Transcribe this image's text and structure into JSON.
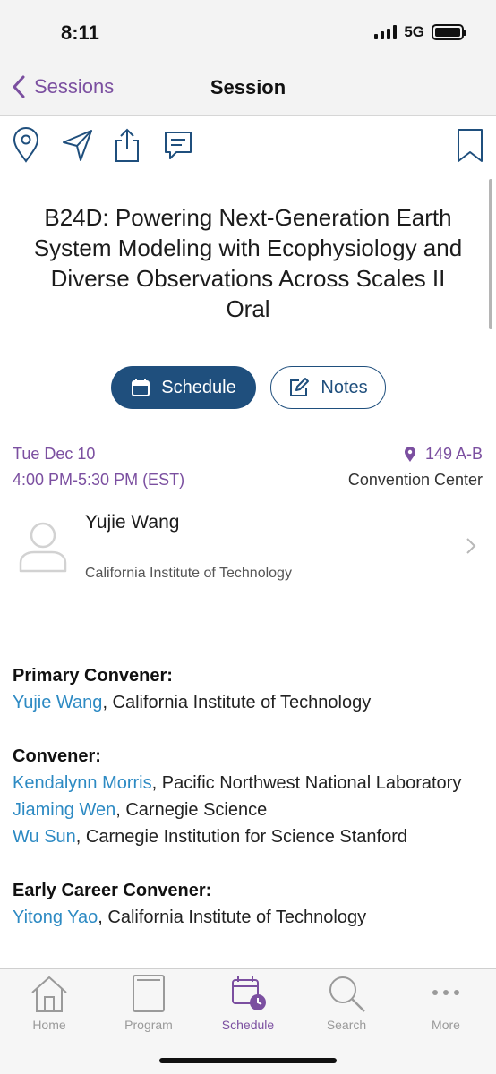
{
  "status": {
    "time": "8:11",
    "network": "5G"
  },
  "nav": {
    "back_label": "Sessions",
    "title": "Session"
  },
  "toolbar": {
    "icons": [
      "location-pin-icon",
      "send-icon",
      "share-icon",
      "comment-icon",
      "bookmark-icon"
    ]
  },
  "session": {
    "title": "B24D: Powering Next-Generation Earth System Modeling with Ecophysiology and Diverse Observations Across Scales II Oral",
    "schedule_label": "Schedule",
    "notes_label": "Notes",
    "date": "Tue Dec 10",
    "time": "4:00 PM-5:30 PM (EST)",
    "room": "149 A-B",
    "venue": "Convention Center"
  },
  "person": {
    "name": "Yujie Wang",
    "affiliation": "California Institute of Technology"
  },
  "conveners": {
    "primary_heading": "Primary Convener:",
    "primary": [
      {
        "name": "Yujie Wang",
        "affiliation": ", California Institute of Technology"
      }
    ],
    "convener_heading": "Convener:",
    "convener": [
      {
        "name": "Kendalynn Morris",
        "affiliation": ", Pacific Northwest National Laboratory"
      },
      {
        "name": "Jiaming Wen",
        "affiliation": ", Carnegie Science"
      },
      {
        "name": "Wu Sun",
        "affiliation": ", Carnegie Institution for Science Stanford"
      }
    ],
    "early_heading": "Early Career Convener:",
    "early": [
      {
        "name": "Yitong Yao",
        "affiliation": ", California Institute of Technology"
      }
    ]
  },
  "tabs": [
    {
      "label": "Home",
      "icon": "home-icon"
    },
    {
      "label": "Program",
      "icon": "book-icon"
    },
    {
      "label": "Schedule",
      "icon": "calendar-clock-icon",
      "active": true
    },
    {
      "label": "Search",
      "icon": "search-icon"
    },
    {
      "label": "More",
      "icon": "more-dots-icon"
    }
  ],
  "colors": {
    "accent": "#7b4fa0",
    "primary": "#1f4f7d",
    "link": "#2d8ac3"
  }
}
